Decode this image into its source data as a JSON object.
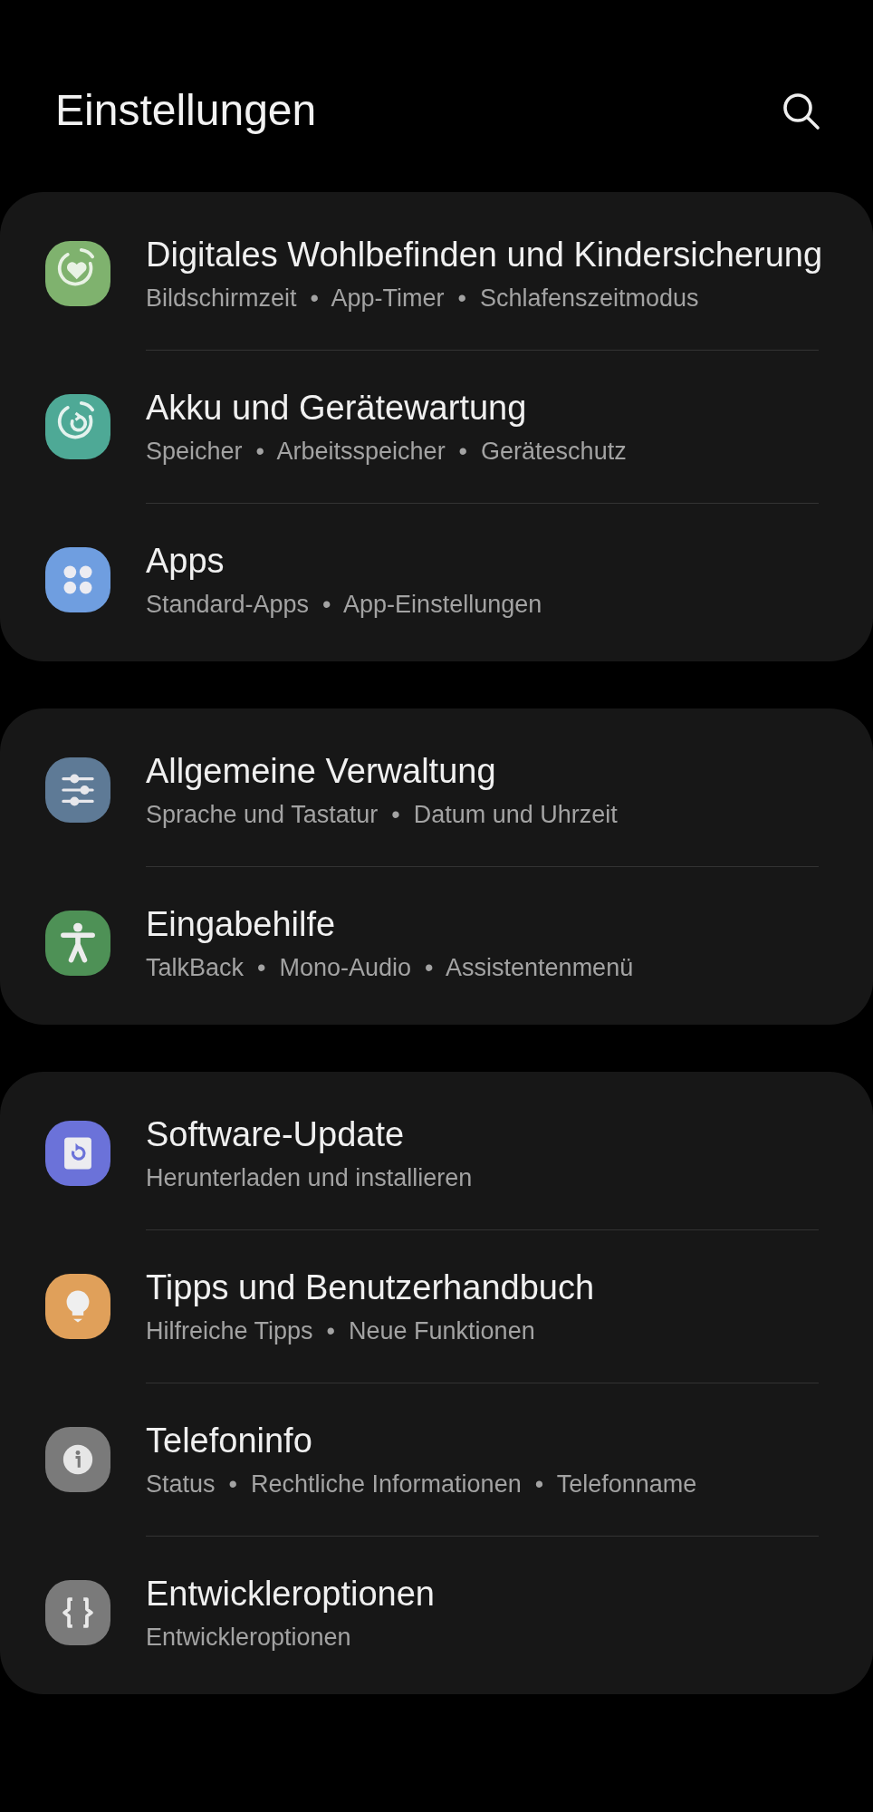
{
  "header": {
    "title": "Einstellungen"
  },
  "groups": [
    {
      "items": [
        {
          "kind": "wellbeing",
          "title": "Digitales Wohlbefinden und Kindersicherung",
          "subtitle": "Bildschirmzeit  •  App-Timer  •  Schlafenszeitmodus"
        },
        {
          "kind": "care",
          "title": "Akku und Gerätewartung",
          "subtitle": "Speicher  •  Arbeitsspeicher  •  Geräteschutz"
        },
        {
          "kind": "apps",
          "title": "Apps",
          "subtitle": "Standard-Apps  •  App-Einstellungen"
        }
      ]
    },
    {
      "items": [
        {
          "kind": "sliders",
          "title": "Allgemeine Verwaltung",
          "subtitle": "Sprache und Tastatur  •  Datum und Uhrzeit"
        },
        {
          "kind": "accessibility",
          "title": "Eingabehilfe",
          "subtitle": "TalkBack  •  Mono-Audio  •  Assistentenmenü"
        }
      ]
    },
    {
      "items": [
        {
          "kind": "update",
          "title": "Software-Update",
          "subtitle": "Herunterladen und installieren"
        },
        {
          "kind": "tips",
          "title": "Tipps und Benutzerhandbuch",
          "subtitle": "Hilfreiche Tipps  •  Neue Funktionen"
        },
        {
          "kind": "info",
          "title": "Telefoninfo",
          "subtitle": "Status  •  Rechtliche Informationen  •  Telefonname"
        },
        {
          "kind": "dev",
          "title": "Entwickleroptionen",
          "subtitle": "Entwickleroptionen"
        }
      ]
    }
  ]
}
